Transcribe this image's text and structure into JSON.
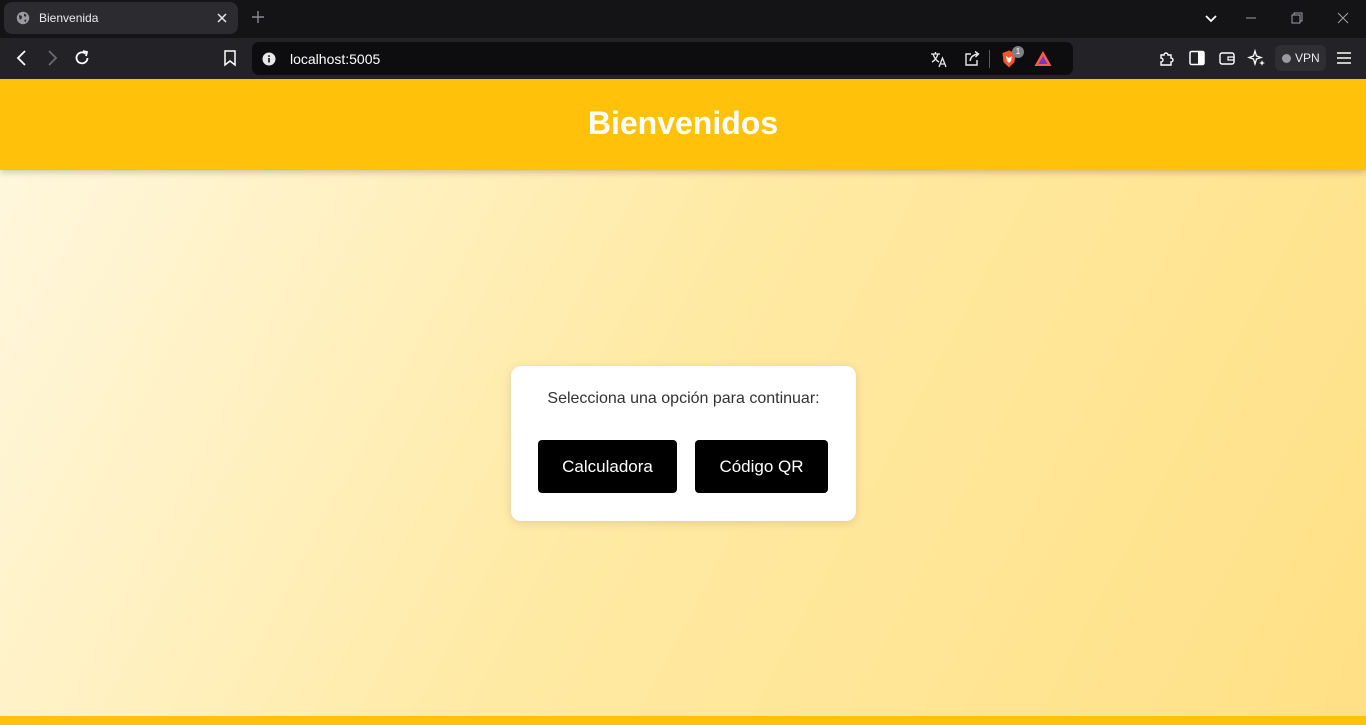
{
  "browser": {
    "tab": {
      "title": "Bienvenida",
      "icon": "globe-icon"
    },
    "address": {
      "url": "localhost:5005"
    },
    "shield_badge": "1",
    "vpn_label": "VPN"
  },
  "page": {
    "header": {
      "title": "Bienvenidos",
      "color": "#ffc10a"
    },
    "card": {
      "prompt": "Selecciona una opción para continuar:",
      "buttons": [
        {
          "label": "Calculadora"
        },
        {
          "label": "Código QR"
        }
      ]
    }
  }
}
